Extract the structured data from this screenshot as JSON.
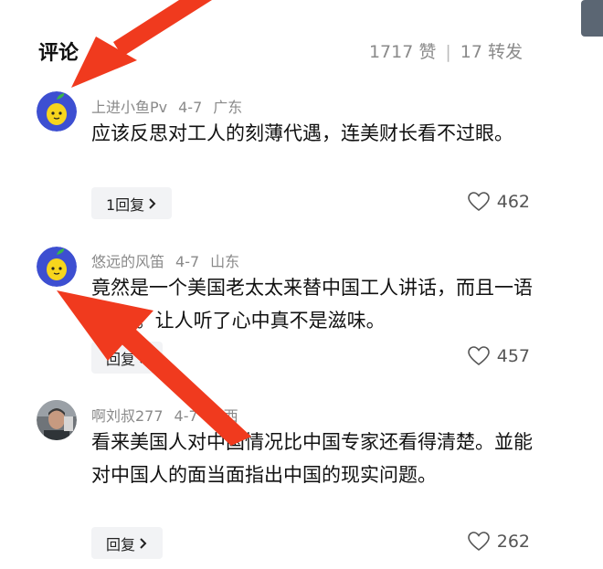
{
  "header": {
    "title": "评论",
    "likes": "1717 赞",
    "divider": "|",
    "shares": "17 转发"
  },
  "comments": [
    {
      "username": "上进小鱼Pv",
      "date": "4-7",
      "location": "广东",
      "text": "应该反思对工人的刻薄代遇，连美财长看不过眼。",
      "reply_label": "1回复",
      "likes": "462",
      "avatar_icon": "lemon-avatar"
    },
    {
      "username": "悠远的风笛",
      "date": "4-7",
      "location": "山东",
      "text": "竟然是一个美国老太太来替中国工人讲话，而且一语中的 。让人听了心中真不是滋味。",
      "reply_label": "回复",
      "likes": "457",
      "avatar_icon": "lemon-avatar"
    },
    {
      "username": "啊刘叔277",
      "date": "4-7",
      "location": "广西",
      "text": "看来美国人对中国情况比中国专家还看得清楚。並能对中国人的面当面指出中国的现实问题。",
      "reply_label": "回复",
      "likes": "262",
      "avatar_icon": "person-photo-avatar"
    }
  ],
  "colors": {
    "arrow": "#f03a1e",
    "meta": "#8a8a8a",
    "reply_bg": "#f2f3f5",
    "avatar_bg": "#3d4fd1",
    "lemon": "#f7d51d"
  }
}
